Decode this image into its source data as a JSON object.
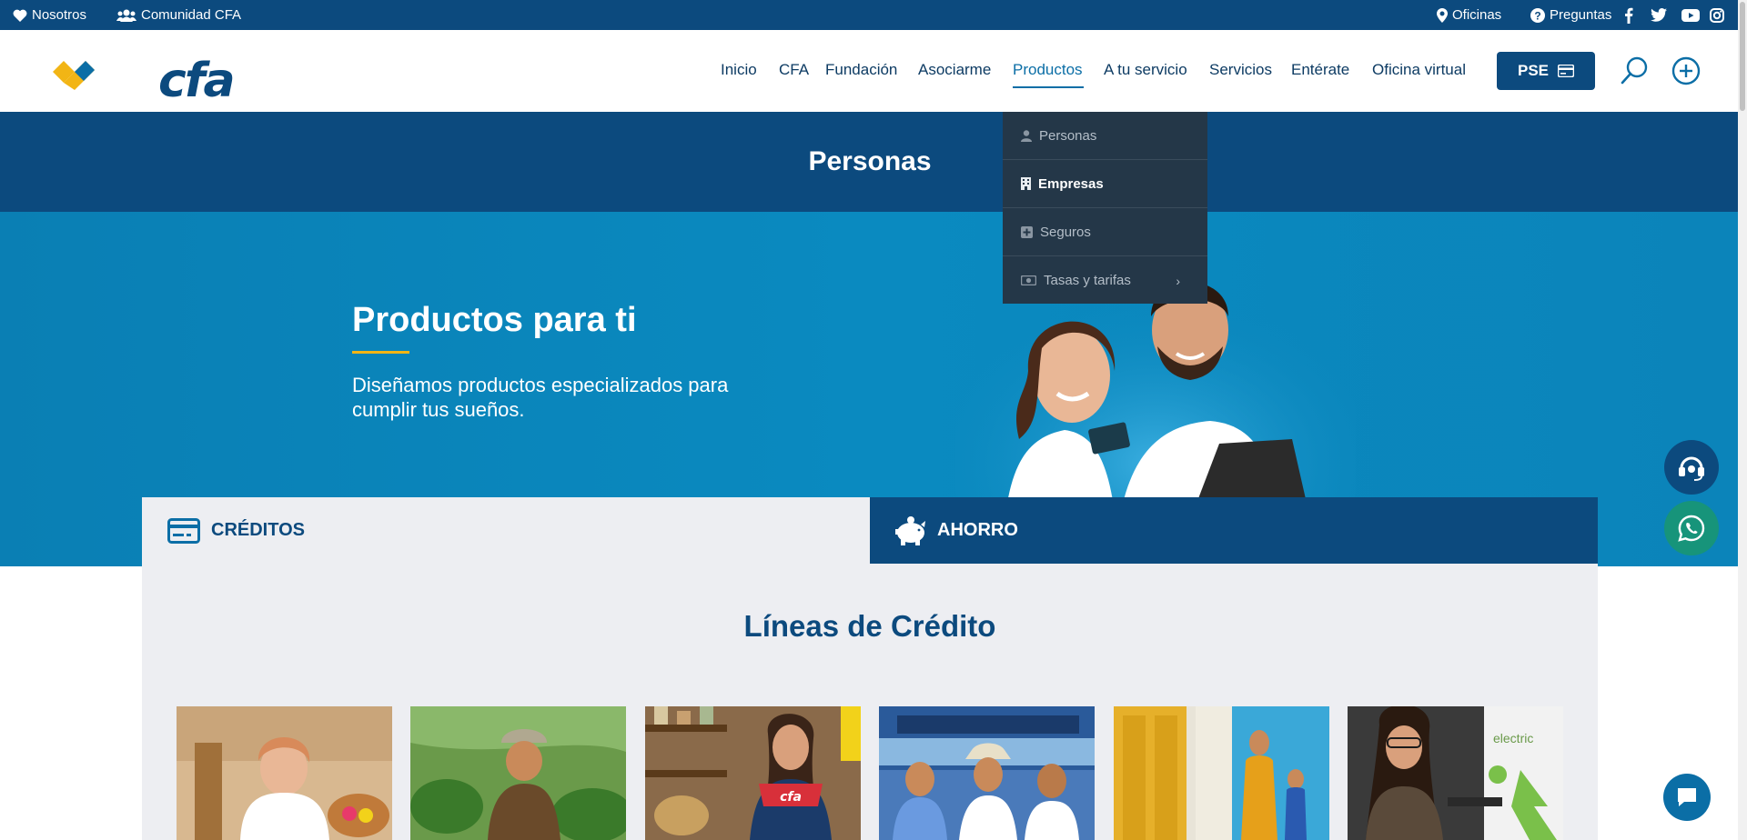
{
  "topbar": {
    "nosotros": "Nosotros",
    "comunidad": "Comunidad CFA",
    "oficinas": "Oficinas",
    "preguntas": "Preguntas"
  },
  "brand": {
    "name": "cfa",
    "primary": "#0c4a7e",
    "accent": "#f2b515",
    "hero": "#0a88be"
  },
  "nav": [
    "Inicio",
    "CFA",
    "Fundación",
    "Asociarme",
    "Productos",
    "A tu servicio",
    "Servicios",
    "Entérate",
    "Oficina virtual"
  ],
  "nav_active": "Productos",
  "pse": "PSE",
  "band": {
    "title": "Personas"
  },
  "dropdown": {
    "items": [
      {
        "label": "Personas",
        "icon": "user-icon"
      },
      {
        "label": "Empresas",
        "icon": "building-icon"
      },
      {
        "label": "Seguros",
        "icon": "plus-square-icon"
      },
      {
        "label": "Tasas y tarifas",
        "icon": "money-icon"
      }
    ]
  },
  "hero": {
    "title": "Productos para ti",
    "subtitle": "Diseñamos productos especializados para cumplir tus sueños."
  },
  "tabs": {
    "creditos": "CRÉDITOS",
    "ahorro": "AHORRO"
  },
  "section": {
    "title": "Líneas de Crédito"
  },
  "cards": [
    {
      "photo": "woman-crafts",
      "bg": "#e6c9a0"
    },
    {
      "photo": "farmer-field",
      "bg": "#5a8a3a"
    },
    {
      "photo": "shop-owner",
      "bg": "#8a5a3a"
    },
    {
      "photo": "bus-men",
      "bg": "#2a5a9a"
    },
    {
      "photo": "yellow-door",
      "bg": "#e6b82a"
    },
    {
      "photo": "electric-charger",
      "bg": "#3a3a3a"
    }
  ],
  "card_photo_labels": {
    "charger": "electric"
  }
}
